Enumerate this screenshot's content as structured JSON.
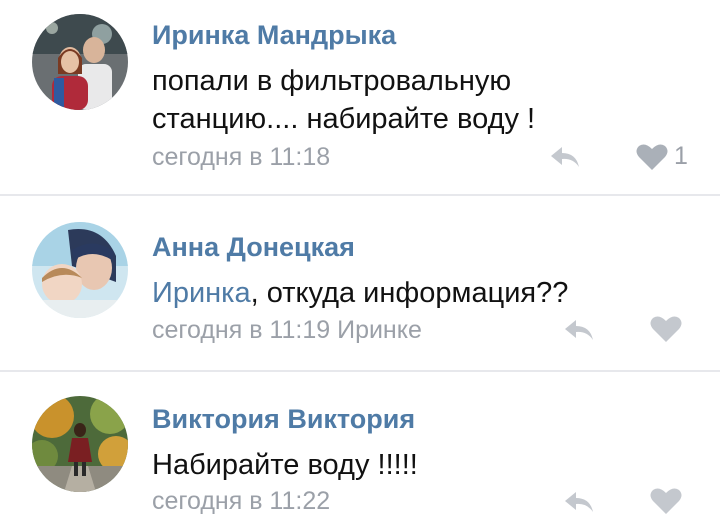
{
  "comments": [
    {
      "author": "Иринка Мандрыка",
      "text_line1": "попали в фильтровальную",
      "text_line2": "станцию.... набирайте воду !",
      "time": "сегодня в 11:18",
      "likes": "1",
      "avatar_icon": "avatar-couple"
    },
    {
      "author": "Анна Донецкая",
      "mention": "Иринка",
      "text_rest": ", откуда информация??",
      "time": "сегодня в 11:19",
      "reply_to": "Иринке",
      "avatar_icon": "avatar-mother-child"
    },
    {
      "author": "Виктория Виктория",
      "text": "Набирайте воду !!!!!",
      "time": "сегодня в 11:22",
      "avatar_icon": "avatar-woman-autumn-park"
    }
  ],
  "colors": {
    "author_link": "#4f7ba6",
    "meta_gray": "#9ba0a8",
    "icon_gray": "#c4c8ce",
    "divider": "#e7e8ec"
  }
}
